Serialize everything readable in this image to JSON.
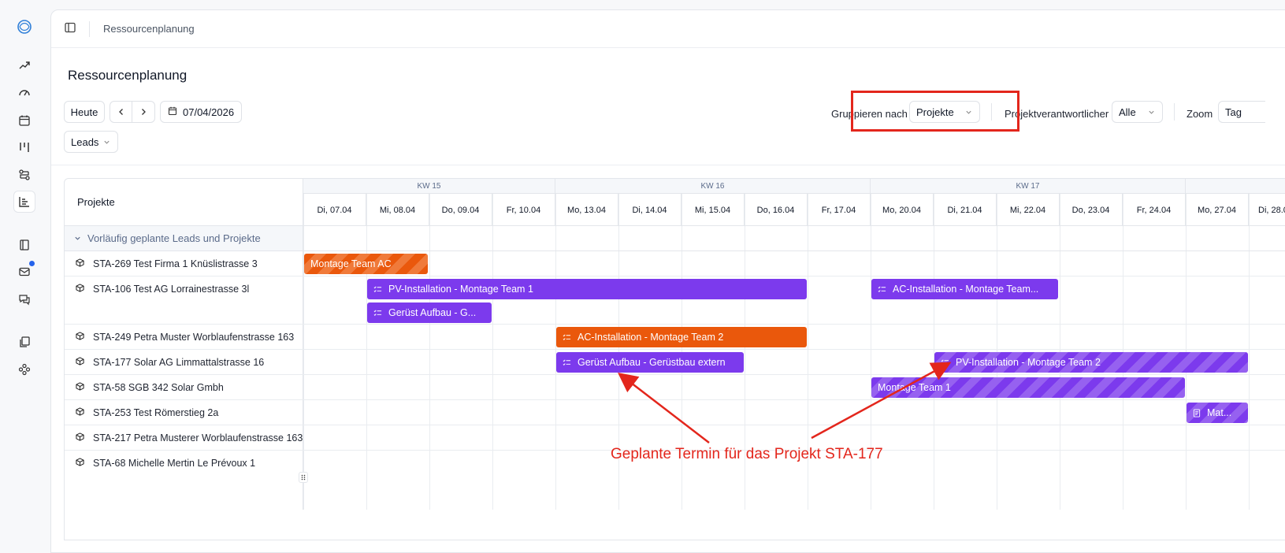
{
  "breadcrumb": "Ressourcenplanung",
  "page_title": "Ressourcenplanung",
  "toolbar": {
    "today_label": "Heute",
    "date_value": "07/04/2026",
    "group_by_label": "Gruppieren nach",
    "group_by_value": "Projekte",
    "manager_label": "Projektverantwortlicher",
    "manager_value": "Alle",
    "zoom_label": "Zoom",
    "zoom_value": "Tag",
    "leads_value": "Leads"
  },
  "grid": {
    "header_label": "Projekte",
    "weeks": [
      "KW 15",
      "KW 16",
      "KW 17"
    ],
    "days": [
      "Di, 07.04",
      "Mi, 08.04",
      "Do, 09.04",
      "Fr, 10.04",
      "Mo, 13.04",
      "Di, 14.04",
      "Mi, 15.04",
      "Do, 16.04",
      "Fr, 17.04",
      "Mo, 20.04",
      "Di, 21.04",
      "Mi, 22.04",
      "Do, 23.04",
      "Fr, 24.04",
      "Mo, 27.04",
      "Di, 28.04"
    ],
    "group_label": "Vorläufig geplante Leads und Projekte",
    "rows": [
      "STA-269 Test Firma 1 Knüslistrasse 3",
      "STA-106 Test AG Lorrainestrasse 3l",
      "STA-249 Petra Muster Worblaufenstrasse 163",
      "STA-177 Solar AG Limmattalstrasse 16",
      "STA-58 SGB 342 Solar Gmbh",
      "STA-253 Test Römerstieg 2a",
      "STA-217 Petra Musterer Worblaufenstrasse 163",
      "STA-68 Michelle Mertin Le Prévoux 1"
    ],
    "bars": [
      "Montage Team AC",
      "PV-Installation - Montage Team 1",
      "AC-Installation - Montage Team...",
      "Gerüst Aufbau - G...",
      "AC-Installation - Montage Team 2",
      "Gerüst Aufbau - Gerüstbau extern",
      "PV-Installation - Montage Team 2",
      "Montage Team 1",
      "Mat..."
    ]
  },
  "annotation": "Geplante Termin für das Projekt STA-177",
  "colors": {
    "accent_red": "#e3261c",
    "purple": "#7c3aed",
    "orange": "#ea580c"
  }
}
